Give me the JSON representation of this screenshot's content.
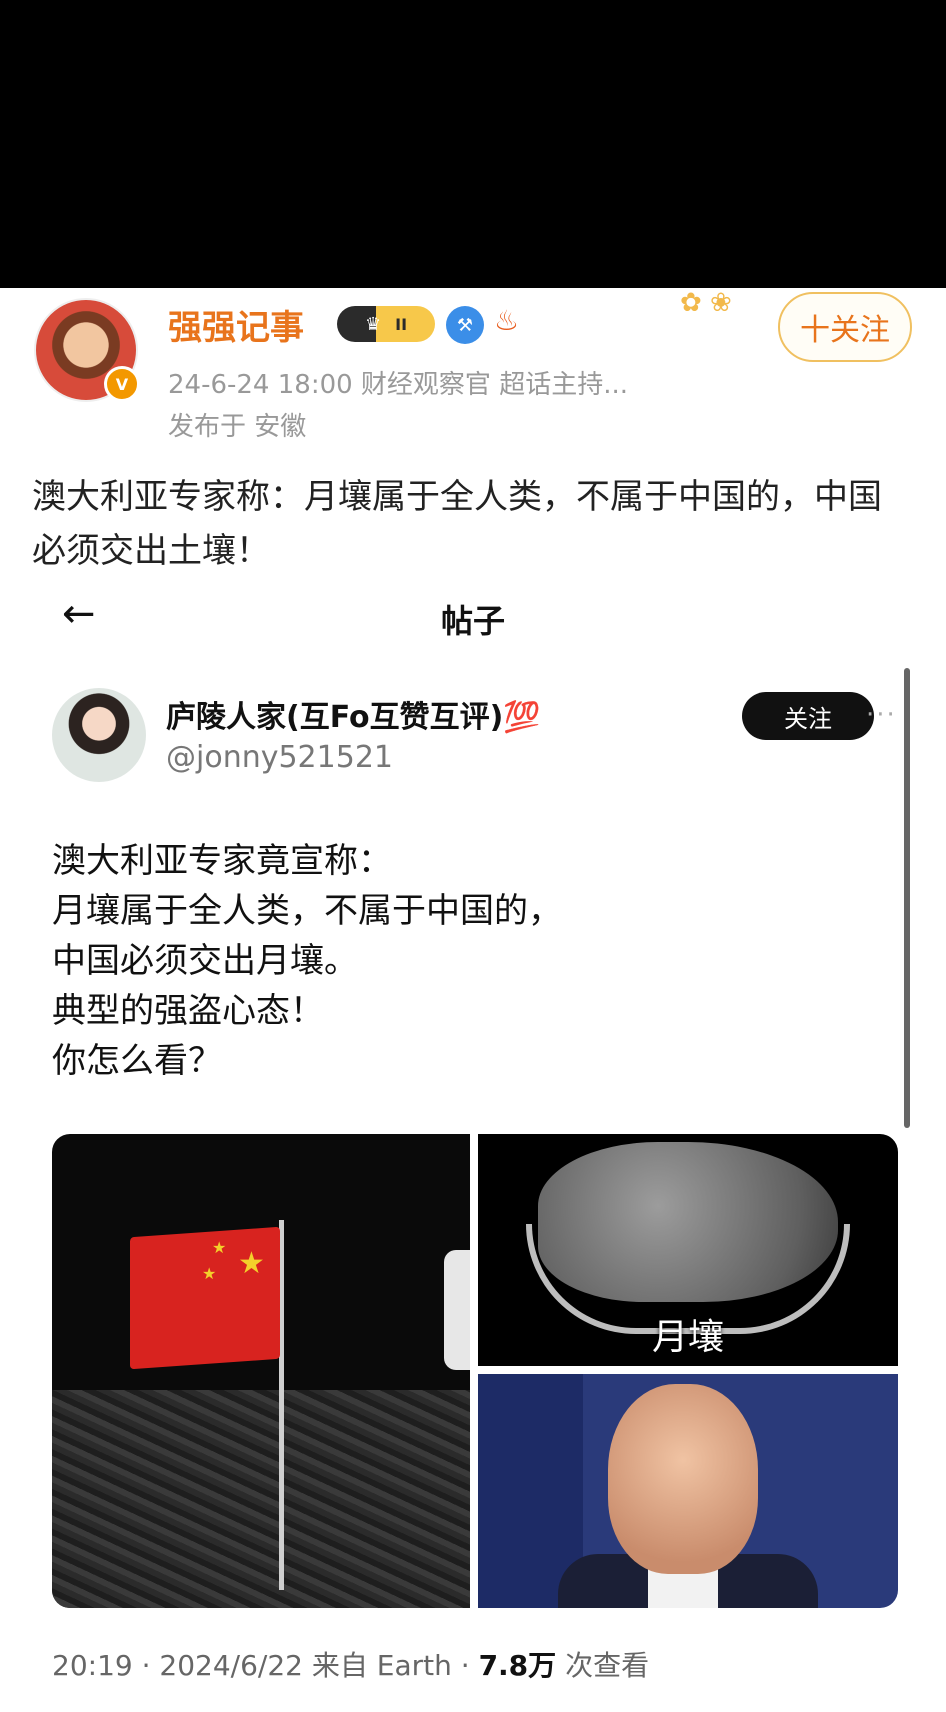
{
  "weibo": {
    "author_name": "强强记事",
    "level_badge": "II",
    "meta": "24-6-24 18:00  财经观察官 超话主持...",
    "location": "发布于 安徽",
    "follow_label": "十关注",
    "text": "澳大利亚专家称：月壤属于全人类，不属于中国的，中国必须交出土壤！"
  },
  "embedded_post": {
    "header_title": "帖子",
    "author_name": "庐陵人家(互Fo互赞互评)💯",
    "handle": "@jonny521521",
    "follow_label": "关注",
    "more": "···",
    "lines": [
      "澳大利亚专家竟宣称：",
      "月壤属于全人类，不属于中国的，",
      "中国必须交出月壤。",
      "典型的强盗心态！",
      "你怎么看？"
    ],
    "image_caption": "月壤",
    "footer_time": "20:19 · 2024/6/22 来自 Earth · ",
    "footer_views": "7.8万",
    "footer_views_suffix": " 次查看"
  }
}
